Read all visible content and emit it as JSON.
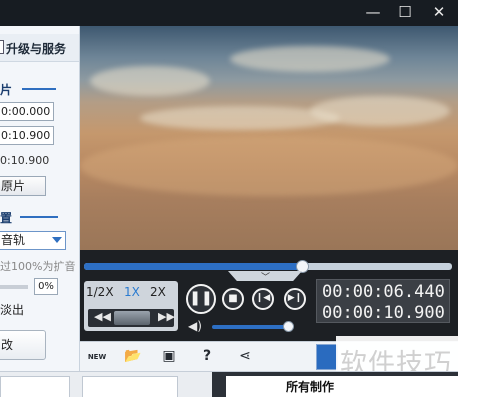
{
  "window": {
    "minimize_glyph": "—",
    "maximize_glyph": "☐",
    "close_glyph": "✕"
  },
  "left_panel": {
    "upgrade_label": "升级与服务",
    "clip_section_title": "片",
    "start_time": "0:00.000",
    "end_time": "0:10.900",
    "duration_text": "0:10.900",
    "original_clip_button": "原片",
    "settings_section_title": "置",
    "audio_track_select": "音轨",
    "volume_hint": "过100%为扩音",
    "volume_percent": "0%",
    "fade_out_label": "淡出",
    "modify_button": "改"
  },
  "player": {
    "progress_fraction": 0.593,
    "speeds": [
      "1/2X",
      "1X",
      "2X"
    ],
    "active_speed": "1X",
    "current_time": "00:00:06.440",
    "total_time": "00:00:10.900",
    "volume_fraction": 0.92,
    "icons": {
      "pause": "pause-icon",
      "stop": "stop-icon",
      "prev": "previous-frame-icon",
      "next": "next-frame-icon",
      "volume": "volume-icon"
    }
  },
  "toolbar": {
    "new_label": "NEW",
    "icons": [
      "new-icon",
      "open-folder-icon",
      "save-icon",
      "help-icon",
      "share-icon",
      "film-icon"
    ]
  },
  "watermark": {
    "text": "软件技巧"
  },
  "bottom": {
    "right_tab_label": "所有制作"
  },
  "colors": {
    "accent_blue": "#2d6fc4",
    "control_bg": "#1d2024",
    "title_bar": "#171c22"
  }
}
